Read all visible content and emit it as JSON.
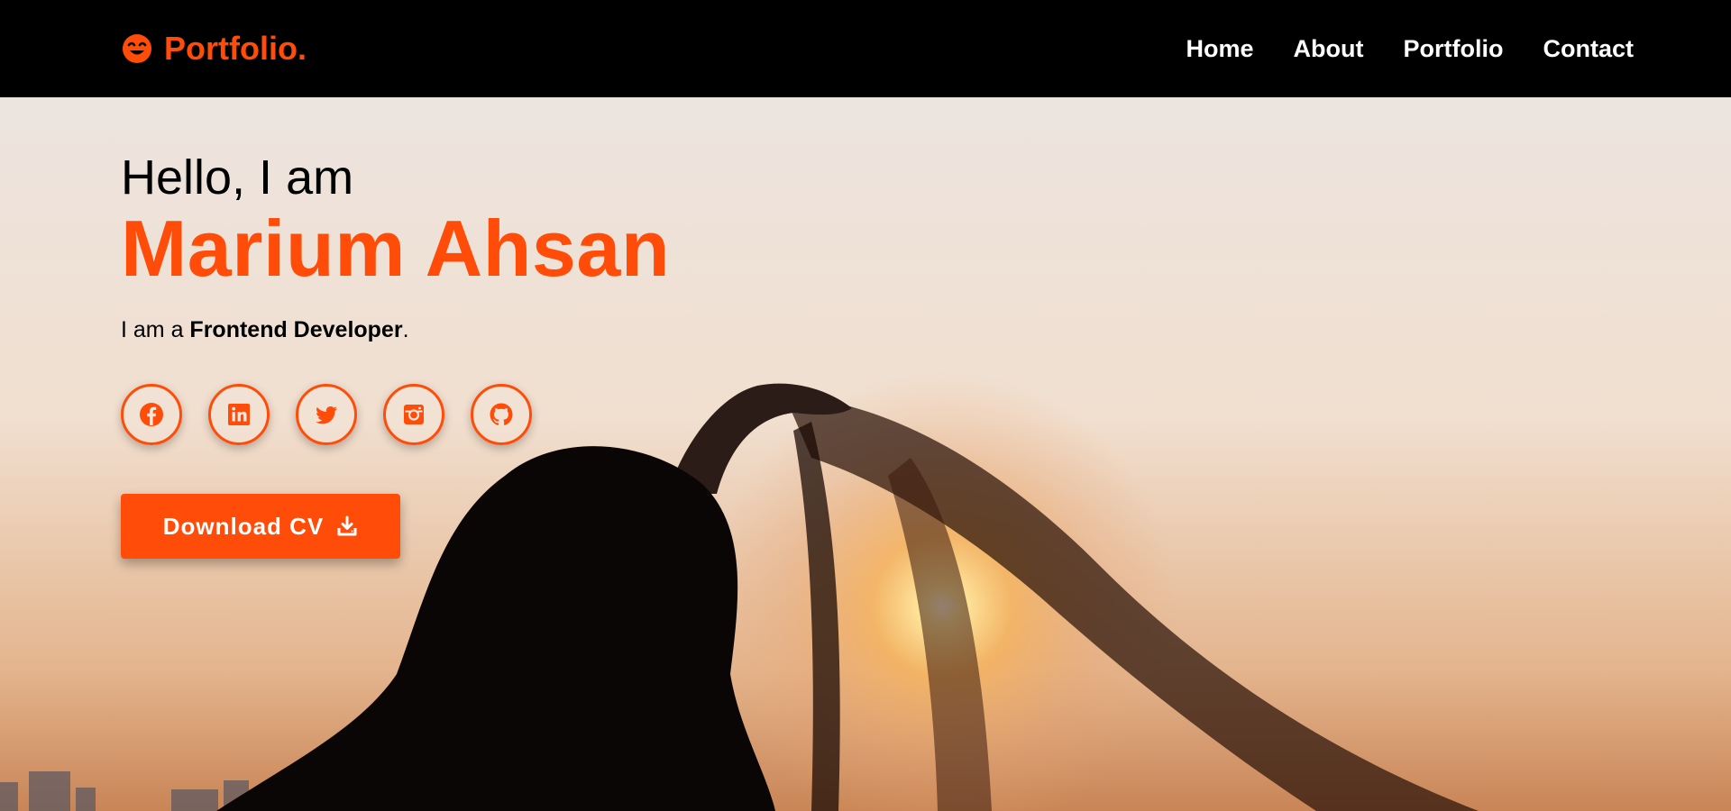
{
  "brand": {
    "name": "Portfolio.",
    "icon": "smile-wink-icon",
    "color": "#ff4c08"
  },
  "nav": {
    "items": [
      {
        "label": "Home"
      },
      {
        "label": "About"
      },
      {
        "label": "Portfolio"
      },
      {
        "label": "Contact"
      }
    ]
  },
  "hero": {
    "greeting": "Hello, I am",
    "name": "Marium Ahsan",
    "tagline_prefix": "I am a ",
    "tagline_role": "Frontend Developer",
    "tagline_suffix": ".",
    "background": "sunset-silhouette-image"
  },
  "socials": [
    {
      "icon": "facebook-icon"
    },
    {
      "icon": "linkedin-icon"
    },
    {
      "icon": "twitter-icon"
    },
    {
      "icon": "instagram-icon"
    },
    {
      "icon": "github-icon"
    }
  ],
  "cv_button": {
    "label": "Download CV",
    "icon": "download-icon"
  },
  "colors": {
    "accent": "#ff4c08",
    "navbar": "#000000"
  }
}
